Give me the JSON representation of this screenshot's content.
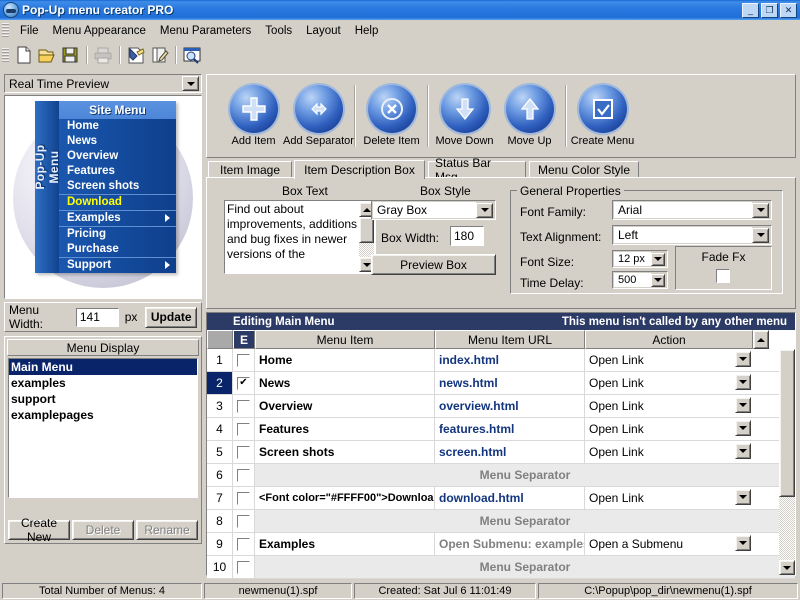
{
  "window": {
    "title": "Pop-Up menu creator PRO",
    "icon": "app-globe-icon",
    "minimize": "_",
    "maximize": "❐",
    "close": "✕"
  },
  "menubar": {
    "items": [
      {
        "label": "File"
      },
      {
        "label": "Menu Appearance"
      },
      {
        "label": "Menu Parameters"
      },
      {
        "label": "Tools"
      },
      {
        "label": "Layout"
      },
      {
        "label": "Help"
      }
    ]
  },
  "toolbar": {
    "icons": [
      "new-document-icon",
      "open-folder-icon",
      "save-disk-icon",
      "print-icon",
      "paint-format-icon",
      "edit-write-icon",
      "preview-search-icon"
    ]
  },
  "preview": {
    "mode_selector": {
      "value": "Real Time Preview",
      "arrow": "chevron-down-icon"
    },
    "popup_menu": {
      "vertical_label": "Pop-Up Menu",
      "title": "Site Menu",
      "items": [
        {
          "label": "Home",
          "style": "normal"
        },
        {
          "label": "News",
          "style": "normal"
        },
        {
          "label": "Overview",
          "style": "normal"
        },
        {
          "label": "Features",
          "style": "normal"
        },
        {
          "label": "Screen shots",
          "style": "normal"
        },
        {
          "label": "Download",
          "style": "yellow",
          "separator_above": true
        },
        {
          "label": "Examples",
          "style": "normal",
          "separator_above": true,
          "submenu": true
        },
        {
          "label": "Pricing",
          "style": "normal",
          "separator_above": true
        },
        {
          "label": "Purchase",
          "style": "normal"
        },
        {
          "label": "Support",
          "style": "normal",
          "separator_above": true,
          "submenu": true
        }
      ]
    },
    "menu_width": {
      "label": "Menu Width:",
      "value": "141",
      "unit": "px",
      "update_button": "Update"
    }
  },
  "menu_display": {
    "title": "Menu Display",
    "items": [
      {
        "label": "Main Menu",
        "selected": true
      },
      {
        "label": "examples",
        "selected": false
      },
      {
        "label": "support",
        "selected": false
      },
      {
        "label": "examplepages",
        "selected": false
      }
    ],
    "buttons": [
      {
        "label": "Create New",
        "enabled": true
      },
      {
        "label": "Delete",
        "enabled": false
      },
      {
        "label": "Rename",
        "enabled": false
      }
    ]
  },
  "big_toolbar": {
    "buttons": [
      {
        "label": "Add Item",
        "icon": "plus-circle-icon"
      },
      {
        "label": "Add Separator",
        "icon": "left-right-arrow-icon"
      },
      {
        "label": "Delete Item",
        "icon": "x-circle-icon"
      },
      {
        "label": "Move Down",
        "icon": "arrow-down-icon"
      },
      {
        "label": "Move Up",
        "icon": "arrow-up-icon"
      },
      {
        "label": "Create Menu",
        "icon": "checkbox-check-icon"
      }
    ]
  },
  "tabs": [
    {
      "label": "Item Image",
      "active": false
    },
    {
      "label": "Item Description Box",
      "active": true
    },
    {
      "label": "Status Bar Msg.",
      "active": false
    },
    {
      "label": "Menu Color Style",
      "active": false
    }
  ],
  "description_panel": {
    "box_text_label": "Box Text",
    "box_text_value": "Find out about improvements, additions and bug fixes in newer versions of the",
    "box_style_label": "Box Style",
    "box_style_value": "Gray Box",
    "box_width_label": "Box Width:",
    "box_width_value": "180",
    "preview_box_button": "Preview Box",
    "general_properties": {
      "title": "General Properties",
      "font_family_label": "Font Family:",
      "font_family_value": "Arial",
      "text_alignment_label": "Text Alignment:",
      "text_alignment_value": "Left",
      "font_size_label": "Font Size:",
      "font_size_value": "12 px",
      "time_delay_label": "Time Delay:",
      "time_delay_value": "500",
      "fade_fx_label": "Fade Fx",
      "fade_fx_checked": false
    }
  },
  "grid": {
    "header_left": "Editing Main Menu",
    "header_right": "This menu isn't called by any other menu",
    "columns": [
      "",
      "E",
      "Menu Item",
      "Menu Item URL",
      "Action"
    ],
    "rows": [
      {
        "n": "1",
        "checked": false,
        "item": "Home",
        "url": "index.html",
        "action": "Open Link",
        "type": "item",
        "selected": false
      },
      {
        "n": "2",
        "checked": true,
        "item": "News",
        "url": "news.html",
        "action": "Open Link",
        "type": "item",
        "selected": true
      },
      {
        "n": "3",
        "checked": false,
        "item": "Overview",
        "url": "overview.html",
        "action": "Open Link",
        "type": "item",
        "selected": false
      },
      {
        "n": "4",
        "checked": false,
        "item": "Features",
        "url": "features.html",
        "action": "Open Link",
        "type": "item",
        "selected": false
      },
      {
        "n": "5",
        "checked": false,
        "item": "Screen shots",
        "url": "screen.html",
        "action": "Open Link",
        "type": "item",
        "selected": false
      },
      {
        "n": "6",
        "checked": false,
        "item": "",
        "url": "",
        "action": "",
        "type": "separator",
        "separator_text": "Menu Separator",
        "selected": false
      },
      {
        "n": "7",
        "checked": false,
        "item": "<Font color=\"#FFFF00\">Downloa",
        "url": "download.html",
        "action": "Open Link",
        "type": "item",
        "selected": false
      },
      {
        "n": "8",
        "checked": false,
        "item": "",
        "url": "",
        "action": "",
        "type": "separator",
        "separator_text": "Menu Separator",
        "selected": false
      },
      {
        "n": "9",
        "checked": false,
        "item": "Examples",
        "url": "Open Submenu: examples",
        "action": "Open a Submenu",
        "type": "submenu",
        "selected": false
      },
      {
        "n": "10",
        "checked": false,
        "item": "",
        "url": "",
        "action": "",
        "type": "separator",
        "separator_text": "Menu Separator",
        "selected": false
      }
    ]
  },
  "statusbar": {
    "panels": [
      "Total Number of Menus: 4",
      "newmenu(1).spf",
      "Created: Sat Jul 6 11:01:49",
      "C:\\Popup\\pop_dir\\newmenu(1).spf"
    ]
  },
  "colors": {
    "titlebar": "#2b7ae0",
    "face": "#d4d0c8",
    "grid_header": "#2c3a66",
    "selection": "#0a246a",
    "url_text": "#13357e",
    "highlight_yellow": "#ffff00"
  }
}
